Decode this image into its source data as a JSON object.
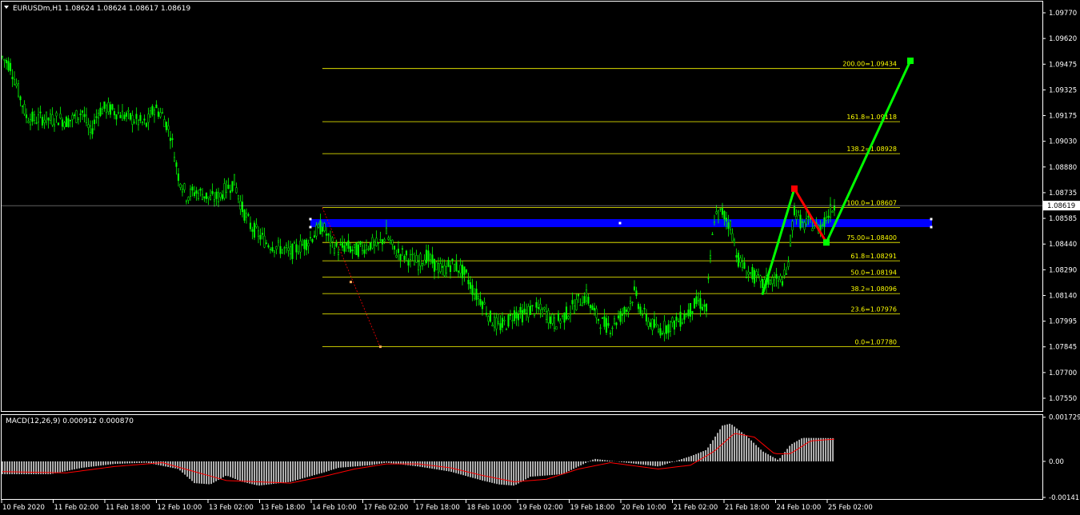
{
  "header": {
    "symbol_info": "EURUSDm,H1  1.08624 1.08624 1.08617 1.08619",
    "dropdown_icon": "triangle-down-icon"
  },
  "macd": {
    "label": "MACD(12,26,9) 0.000912 0.000870"
  },
  "current_price_label": "1.08619",
  "colors": {
    "background": "#000000",
    "frame": "#ffffff",
    "candles": "#00ff00",
    "fib_levels": "#ffff00",
    "fib_zone": "#0000ff",
    "macd_hist": "#c0c0c0",
    "macd_signal": "#ff0000",
    "wave_up": "#00ff00",
    "wave_down": "#ff0000",
    "trend_line": "#ff0000"
  },
  "chart_data": [
    {
      "type": "candlestick",
      "symbol": "EURUSDm",
      "timeframe": "H1",
      "ohlc_last": {
        "open": 1.08624,
        "high": 1.08624,
        "low": 1.08617,
        "close": 1.08619
      },
      "ylim": [
        1.0755,
        1.0977
      ],
      "y_ticks": [
        "1.09770",
        "1.09620",
        "1.09475",
        "1.09325",
        "1.09175",
        "1.09030",
        "1.08880",
        "1.08735",
        "1.08585",
        "1.08440",
        "1.08290",
        "1.08140",
        "1.07995",
        "1.07845",
        "1.07700",
        "1.07550"
      ],
      "x_ticks": [
        "10 Feb 2020",
        "11 Feb 02:00",
        "11 Feb 18:00",
        "12 Feb 10:00",
        "13 Feb 02:00",
        "13 Feb 18:00",
        "14 Feb 10:00",
        "17 Feb 02:00",
        "17 Feb 18:00",
        "18 Feb 10:00",
        "19 Feb 02:00",
        "19 Feb 18:00",
        "20 Feb 10:00",
        "21 Feb 02:00",
        "21 Feb 18:00",
        "24 Feb 10:00",
        "25 Feb 02:00"
      ],
      "price_path": [
        [
          0,
          1.095
        ],
        [
          10,
          1.0945
        ],
        [
          20,
          1.093
        ],
        [
          30,
          1.0915
        ],
        [
          40,
          1.0913
        ],
        [
          50,
          1.0914
        ],
        [
          60,
          1.0913
        ],
        [
          70,
          1.0914
        ],
        [
          80,
          1.0912
        ],
        [
          90,
          1.0914
        ],
        [
          100,
          1.0918
        ],
        [
          110,
          1.0905
        ],
        [
          120,
          1.0918
        ],
        [
          130,
          1.092
        ],
        [
          140,
          1.0918
        ],
        [
          150,
          1.0916
        ],
        [
          160,
          1.0914
        ],
        [
          170,
          1.0912
        ],
        [
          180,
          1.091
        ],
        [
          190,
          1.092
        ],
        [
          200,
          1.0916
        ],
        [
          210,
          1.0905
        ],
        [
          220,
          1.088
        ],
        [
          230,
          1.0868
        ],
        [
          240,
          1.087
        ],
        [
          250,
          1.0869
        ],
        [
          260,
          1.0866
        ],
        [
          270,
          1.0867
        ],
        [
          280,
          1.0872
        ],
        [
          290,
          1.0876
        ],
        [
          300,
          1.086
        ],
        [
          310,
          1.085
        ],
        [
          320,
          1.0845
        ],
        [
          330,
          1.084
        ],
        [
          340,
          1.0838
        ],
        [
          350,
          1.0836
        ],
        [
          360,
          1.0834
        ],
        [
          370,
          1.0837
        ],
        [
          380,
          1.084
        ],
        [
          390,
          1.0845
        ],
        [
          400,
          1.085
        ],
        [
          410,
          1.084
        ],
        [
          420,
          1.0836
        ],
        [
          430,
          1.0838
        ],
        [
          440,
          1.0835
        ],
        [
          450,
          1.0837
        ],
        [
          460,
          1.0839
        ],
        [
          470,
          1.0838
        ],
        [
          480,
          1.0845
        ],
        [
          490,
          1.0835
        ],
        [
          500,
          1.0833
        ],
        [
          510,
          1.083
        ],
        [
          520,
          1.0828
        ],
        [
          530,
          1.0832
        ],
        [
          540,
          1.0827
        ],
        [
          550,
          1.0823
        ],
        [
          560,
          1.0827
        ],
        [
          570,
          1.0825
        ],
        [
          580,
          1.082
        ],
        [
          590,
          1.081
        ],
        [
          600,
          1.0805
        ],
        [
          610,
          1.0795
        ],
        [
          620,
          1.079
        ],
        [
          630,
          1.0792
        ],
        [
          640,
          1.0798
        ],
        [
          650,
          1.0797
        ],
        [
          660,
          1.08
        ],
        [
          670,
          1.08
        ],
        [
          680,
          1.0798
        ],
        [
          690,
          1.0792
        ],
        [
          700,
          1.0795
        ],
        [
          710,
          1.08
        ],
        [
          720,
          1.0805
        ],
        [
          730,
          1.0808
        ],
        [
          740,
          1.0798
        ],
        [
          750,
          1.0792
        ],
        [
          760,
          1.079
        ],
        [
          770,
          1.0795
        ],
        [
          780,
          1.08
        ],
        [
          790,
          1.081
        ],
        [
          800,
          1.0798
        ],
        [
          810,
          1.0792
        ],
        [
          820,
          1.0788
        ],
        [
          830,
          1.079
        ],
        [
          840,
          1.0792
        ],
        [
          850,
          1.0795
        ],
        [
          860,
          1.08
        ],
        [
          870,
          1.0805
        ],
        [
          880,
          1.08
        ],
        [
          885,
          1.083
        ],
        [
          890,
          1.0855
        ],
        [
          900,
          1.0858
        ],
        [
          910,
          1.085
        ],
        [
          920,
          1.083
        ],
        [
          930,
          1.0823
        ],
        [
          940,
          1.082
        ],
        [
          950,
          1.0815
        ],
        [
          960,
          1.0818
        ],
        [
          970,
          1.0817
        ],
        [
          980,
          1.082
        ],
        [
          990,
          1.086
        ],
        [
          1000,
          1.085
        ],
        [
          1010,
          1.0852
        ],
        [
          1020,
          1.0848
        ],
        [
          1030,
          1.0855
        ],
        [
          1040,
          1.0862
        ]
      ],
      "fibonacci": [
        {
          "label": "200.00=1.09434",
          "value": 1.09434
        },
        {
          "label": "161.8=1.09118",
          "value": 1.09118
        },
        {
          "label": "138.2=1.08928",
          "value": 1.08928
        },
        {
          "label": "100.0=1.08607",
          "value": 1.08607
        },
        {
          "label": "75.00=1.08400",
          "value": 1.084
        },
        {
          "label": "61.8=1.08291",
          "value": 1.08291
        },
        {
          "label": "50.0=1.08194",
          "value": 1.08194
        },
        {
          "label": "38.2=1.08096",
          "value": 1.08096
        },
        {
          "label": "23.6=1.07976",
          "value": 1.07976
        },
        {
          "label": "0.0=1.07780",
          "value": 1.0778
        }
      ],
      "current_price": 1.08619,
      "wave_points": [
        {
          "x": 950,
          "y": 1.0809,
          "color": "#00ff00"
        },
        {
          "x": 990,
          "y": 1.0872,
          "color": "#ff0000"
        },
        {
          "x": 1030,
          "y": 1.084,
          "color": "#00ff00"
        },
        {
          "x": 1135,
          "y": 1.0948,
          "color": "#00ff00"
        }
      ]
    },
    {
      "type": "bar",
      "name": "MACD(12,26,9)",
      "main": 0.000912,
      "signal": 0.00087,
      "ylim": [
        -0.00141,
        0.00172
      ],
      "y_ticks": [
        "0.001729",
        "0.00",
        "-0.00141"
      ],
      "hist_path": [
        [
          0,
          -0.0005
        ],
        [
          60,
          -0.0005
        ],
        [
          100,
          -0.00025
        ],
        [
          140,
          -0.0001
        ],
        [
          180,
          -5e-05
        ],
        [
          220,
          -0.0003
        ],
        [
          240,
          -0.00085
        ],
        [
          260,
          -0.0009
        ],
        [
          280,
          -0.00055
        ],
        [
          300,
          -0.0008
        ],
        [
          320,
          -0.00095
        ],
        [
          360,
          -0.0008
        ],
        [
          400,
          -0.00045
        ],
        [
          420,
          -0.00025
        ],
        [
          460,
          -0.00015
        ],
        [
          480,
          -5e-05
        ],
        [
          520,
          -0.0002
        ],
        [
          560,
          -0.0004
        ],
        [
          600,
          -0.00075
        ],
        [
          620,
          -0.0009
        ],
        [
          640,
          -0.00095
        ],
        [
          660,
          -0.0006
        ],
        [
          700,
          -0.0005
        ],
        [
          740,
          0.0001
        ],
        [
          780,
          -5e-05
        ],
        [
          820,
          -0.0002
        ],
        [
          860,
          0.0002
        ],
        [
          880,
          0.00045
        ],
        [
          900,
          0.0014
        ],
        [
          910,
          0.00148
        ],
        [
          930,
          0.001
        ],
        [
          950,
          0.0004
        ],
        [
          970,
          5e-05
        ],
        [
          985,
          0.00065
        ],
        [
          1000,
          0.00092
        ],
        [
          1040,
          0.00091
        ]
      ],
      "signal_path": [
        [
          0,
          -0.0004
        ],
        [
          80,
          -0.00045
        ],
        [
          140,
          -0.0002
        ],
        [
          200,
          -5e-05
        ],
        [
          240,
          -0.0004
        ],
        [
          280,
          -0.00075
        ],
        [
          320,
          -0.0008
        ],
        [
          360,
          -0.00085
        ],
        [
          400,
          -0.0006
        ],
        [
          440,
          -0.0003
        ],
        [
          480,
          -0.0001
        ],
        [
          520,
          -0.0001
        ],
        [
          560,
          -0.00025
        ],
        [
          600,
          -0.00055
        ],
        [
          640,
          -0.0008
        ],
        [
          680,
          -0.0007
        ],
        [
          720,
          -0.0003
        ],
        [
          760,
          -5e-05
        ],
        [
          820,
          -0.0003
        ],
        [
          860,
          -0.00015
        ],
        [
          890,
          0.0004
        ],
        [
          915,
          0.0011
        ],
        [
          940,
          0.00095
        ],
        [
          965,
          0.0003
        ],
        [
          985,
          0.0003
        ],
        [
          1010,
          0.0008
        ],
        [
          1040,
          0.00087
        ]
      ]
    }
  ]
}
